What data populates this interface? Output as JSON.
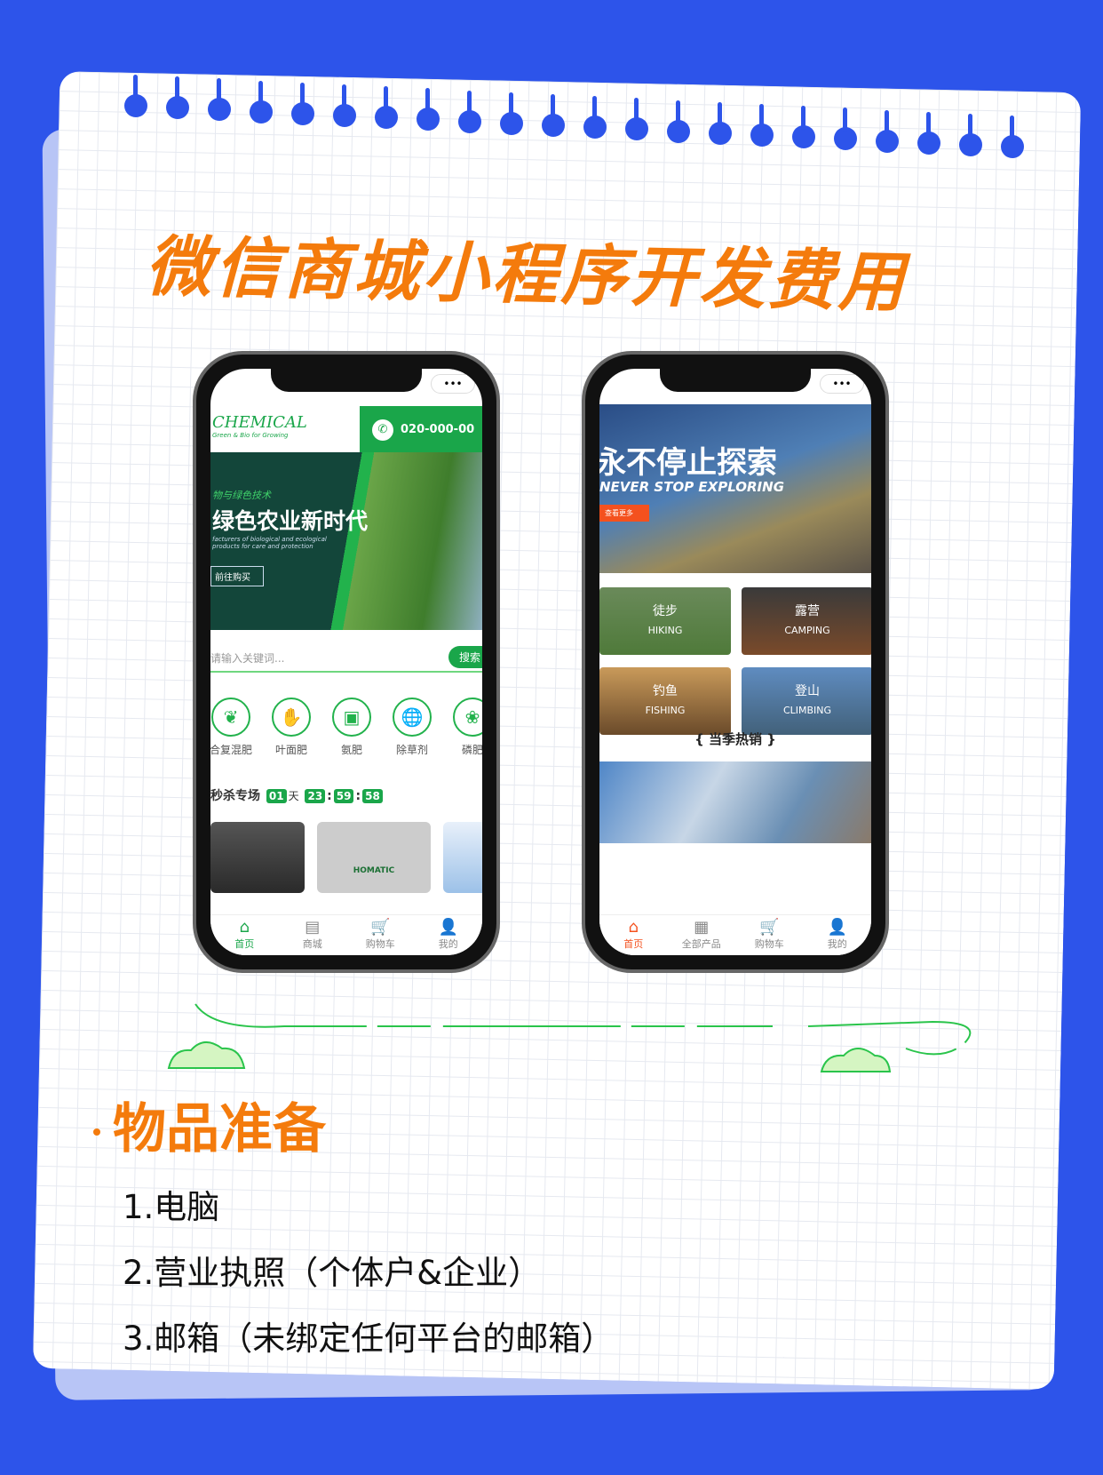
{
  "title": "微信商城小程序开发费用",
  "left_phone": {
    "logo": "CHEMICAL",
    "logo_tagline": "Green & Bio for Growing",
    "phone_number": "020-000-00",
    "banner": {
      "kicker": "物与绿色技术",
      "headline": "绿色农业新时代",
      "subtitle": "facturers of biological and ecological products for care and protection",
      "cta": "前往购买"
    },
    "search": {
      "placeholder": "请输入关键词...",
      "button": "搜索"
    },
    "categories": [
      {
        "label": "合复混肥",
        "icon": "sprout-icon"
      },
      {
        "label": "叶面肥",
        "icon": "hand-plant-icon"
      },
      {
        "label": "氨肥",
        "icon": "fertilizer-bag-icon"
      },
      {
        "label": "除草剂",
        "icon": "globe-arrow-icon"
      },
      {
        "label": "磷肥",
        "icon": "wheat-icon"
      }
    ],
    "flash_sale": {
      "title": "秒杀专场",
      "days": "01",
      "day_unit": "天",
      "hours": "23",
      "minutes": "59",
      "seconds": "58"
    },
    "product_label": "HOMATIC",
    "tabs": [
      "首页",
      "商城",
      "购物车",
      "我的"
    ],
    "accent": "#1aa64a"
  },
  "right_phone": {
    "banner": {
      "headline": "永不停止探索",
      "subtitle": "NEVER STOP EXPLORING",
      "cta": "查看更多"
    },
    "tiles": [
      {
        "cn": "徒步",
        "en": "HIKING"
      },
      {
        "cn": "露营",
        "en": "CAMPING"
      },
      {
        "cn": "钓鱼",
        "en": "FISHING"
      },
      {
        "cn": "登山",
        "en": "CLIMBING"
      }
    ],
    "section_title": "{ 当季热销 }",
    "tabs": [
      "首页",
      "全部产品",
      "购物车",
      "我的"
    ],
    "accent": "#f4511e"
  },
  "prep": {
    "heading": "物品准备",
    "items": [
      "1.电脑",
      "2.营业执照（个体户&企业）",
      "3.邮箱（未绑定任何平台的邮箱）"
    ]
  }
}
